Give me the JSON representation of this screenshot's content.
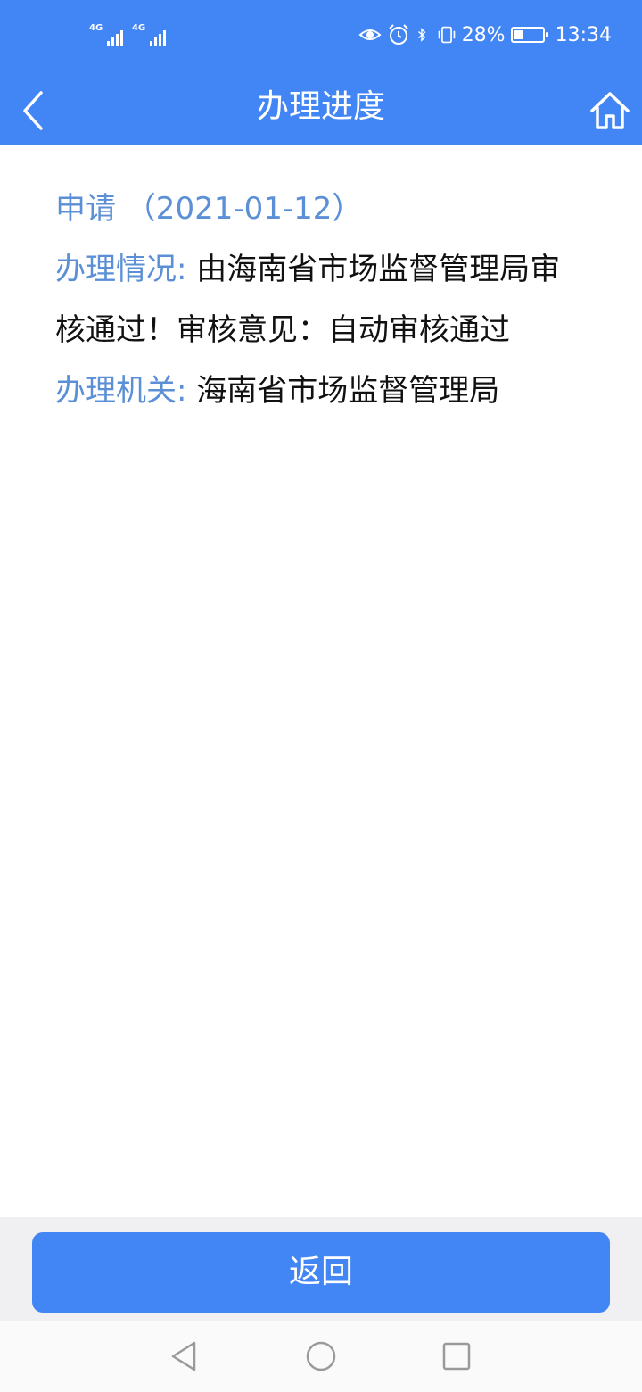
{
  "status_bar": {
    "network_1": "4G",
    "network_2": "4G",
    "battery_percent": "28%",
    "time": "13:34",
    "icons": [
      "eye-icon",
      "alarm-icon",
      "bluetooth-icon",
      "vibrate-icon",
      "battery-icon"
    ]
  },
  "header": {
    "title": "办理进度",
    "back_icon": "chevron-left-icon",
    "home_icon": "home-icon"
  },
  "progress": {
    "apply_line": "申请 （2021-01-12）",
    "status_label": "办理情况:",
    "status_value": "由海南省市场监督管理局审核通过！审核意见：自动审核通过",
    "authority_label": "办理机关:",
    "authority_value": "海南省市场监督管理局"
  },
  "footer": {
    "return_label": "返回"
  },
  "system_nav": {
    "icons": [
      "back-triangle-icon",
      "home-circle-icon",
      "recents-square-icon"
    ]
  },
  "colors": {
    "primary": "#4285f4",
    "label_blue": "#5b8fd6",
    "text": "#111111",
    "footer_bg": "#f0f0f2"
  }
}
